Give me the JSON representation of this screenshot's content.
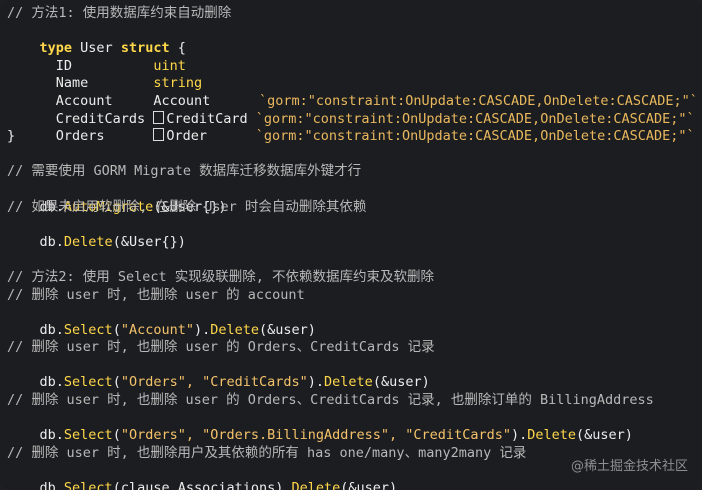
{
  "lines": [
    {
      "c1": "// 方法1: 使用数据库约束自动删除"
    },
    {
      "kw": "type",
      "name": " User ",
      "kw2": "struct",
      "brace": " {"
    },
    {
      "field": "  ID          ",
      "type": "uint"
    },
    {
      "field": "  Name        ",
      "type": "string"
    },
    {
      "field": "  Account     ",
      "type": "Account      ",
      "tag": "`gorm:\"constraint:OnUpdate:CASCADE,OnDelete:CASCADE;\"`"
    },
    {
      "field": "  CreditCards ",
      "type": "CreditCard ",
      "tag": "`gorm:\"constraint:OnUpdate:CASCADE,OnDelete:CASCADE;\"`"
    },
    {
      "field": "  Orders      ",
      "type": "Order      ",
      "tag": "`gorm:\"constraint:OnUpdate:CASCADE,OnDelete:CASCADE;\"`"
    },
    {
      "brace": "}"
    },
    {
      "blank": ""
    },
    {
      "c1": "// 需要使用 GORM Migrate 数据库迁移数据库外键才行"
    },
    {
      "recv": "db.",
      "fn": "AutoMigrate",
      "args": "(&User{})"
    },
    {
      "c1": "// 如果未启用软删除, 在删除 User 时会自动删除其依赖"
    },
    {
      "recv": "db.",
      "fn": "Delete",
      "args": "(&User{})"
    },
    {
      "blank": ""
    },
    {
      "blank": ""
    },
    {
      "c1": "// 方法2: 使用 Select 实现级联删除, 不依赖数据库约束及软删除"
    },
    {
      "c1": "// 删除 user 时, 也删除 user 的 account"
    },
    {
      "recv": "db.",
      "fn": "Select",
      "args_pre": "(",
      "str": "\"Account\"",
      "args_post": ").",
      "fn2": "Delete",
      "args2": "(&user)"
    },
    {
      "blank": ""
    },
    {
      "c1": "// 删除 user 时, 也删除 user 的 Orders、CreditCards 记录"
    },
    {
      "recv": "db.",
      "fn": "Select",
      "args_pre": "(",
      "str": "\"Orders\", \"CreditCards\"",
      "args_post": ").",
      "fn2": "Delete",
      "args2": "(&user)"
    },
    {
      "blank": ""
    },
    {
      "c1": "// 删除 user 时, 也删除 user 的 Orders、CreditCards 记录, 也删除订单的 BillingAddress"
    },
    {
      "recv": "db.",
      "fn": "Select",
      "args_pre": "(",
      "str": "\"Orders\", \"Orders.BillingAddress\", \"CreditCards\"",
      "args_post": ").",
      "fn2": "Delete",
      "args2": "(&user)"
    },
    {
      "blank": ""
    },
    {
      "c1": "// 删除 user 时, 也删除用户及其依赖的所有 has one/many、many2many 记录"
    },
    {
      "recv": "db.",
      "fn": "Select",
      "args_pre": "(clause.Associations).",
      "fn2": "Delete",
      "args2": "(&user)"
    }
  ],
  "watermark": "@稀土掘金技术社区"
}
